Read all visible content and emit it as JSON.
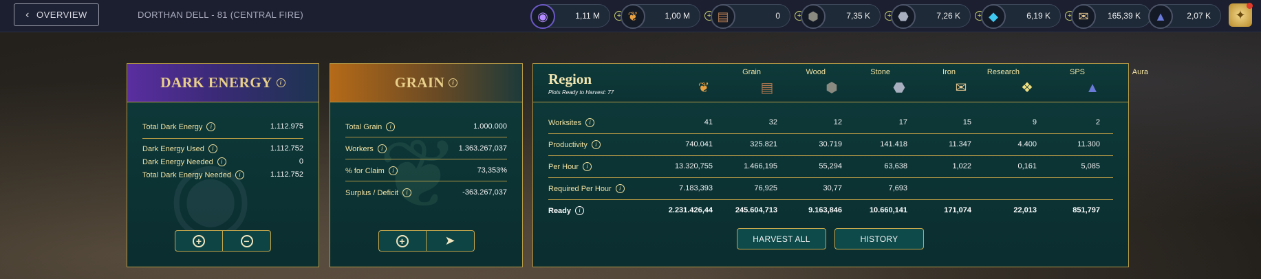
{
  "topbar": {
    "overview_label": "OVERVIEW",
    "location": "DORTHAN DELL - 81 (CENTRAL FIRE)",
    "resources": [
      {
        "icon": "dark-energy-icon",
        "value": "1,11 M"
      },
      {
        "icon": "grain-icon",
        "value": "1,00 M"
      },
      {
        "icon": "wood-icon",
        "value": "0"
      },
      {
        "icon": "stone-icon",
        "value": "7,35 K"
      },
      {
        "icon": "iron-icon",
        "value": "7,26 K"
      },
      {
        "icon": "crystal-icon",
        "value": "6,19 K"
      },
      {
        "icon": "research-icon",
        "value": "165,39 K"
      },
      {
        "icon": "aura-icon",
        "value": "2,07 K"
      }
    ]
  },
  "dark_energy": {
    "title": "DARK ENERGY",
    "rows": [
      {
        "label": "Total Dark Energy",
        "value": "1.112.975"
      },
      {
        "label": "Dark Energy Used",
        "value": "1.112.752"
      },
      {
        "label": "Dark Energy Needed",
        "value": "0"
      },
      {
        "label": "Total Dark Energy Needed",
        "value": "1.112.752"
      }
    ]
  },
  "grain": {
    "title": "GRAIN",
    "rows": [
      {
        "label": "Total Grain",
        "value": "1.000.000"
      },
      {
        "label": "Workers",
        "value": "1.363.267,037"
      },
      {
        "label": "% for Claim",
        "value": "73,353%"
      },
      {
        "label": "Surplus / Deficit",
        "value": "-363.267,037"
      }
    ]
  },
  "region": {
    "title": "Region",
    "subtitle": "Plots Ready to Harvest: 77",
    "columns": [
      "Grain",
      "Wood",
      "Stone",
      "Iron",
      "Research",
      "SPS",
      "Aura"
    ],
    "rows": [
      {
        "label": "Worksites",
        "values": [
          "41",
          "32",
          "12",
          "17",
          "15",
          "9",
          "2"
        ]
      },
      {
        "label": "Productivity",
        "values": [
          "740.041",
          "325.821",
          "30.719",
          "141.418",
          "11.347",
          "4.400",
          "11.300"
        ]
      },
      {
        "label": "Per Hour",
        "values": [
          "13.320,755",
          "1.466,195",
          "55,294",
          "63,638",
          "1,022",
          "0,161",
          "5,085"
        ]
      },
      {
        "label": "Required Per Hour",
        "values": [
          "7.183,393",
          "76,925",
          "30,77",
          "7,693",
          "",
          "",
          ""
        ]
      },
      {
        "label": "Ready",
        "values": [
          "2.231.426,44",
          "245.604,713",
          "9.163,846",
          "10.660,141",
          "171,074",
          "22,013",
          "851,797"
        ]
      }
    ],
    "harvest_all_label": "HARVEST ALL",
    "history_label": "HISTORY"
  },
  "colors": {
    "panel_border": "#b79a45",
    "panel_bg": "#0e3a3a",
    "label_gold": "#f2e2a0"
  }
}
